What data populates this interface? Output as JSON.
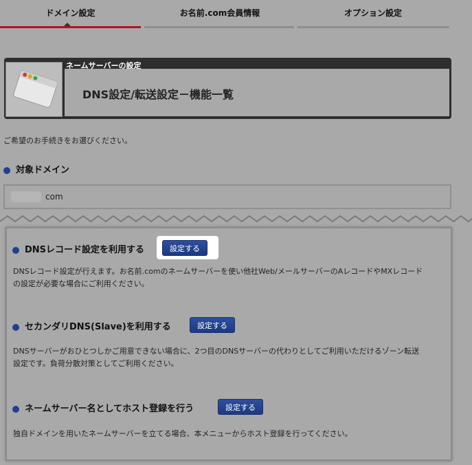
{
  "tabs": [
    {
      "label": "ドメイン設定",
      "active": true
    },
    {
      "label": "お名前.com会員情報",
      "active": false
    },
    {
      "label": "オプション設定",
      "active": false
    }
  ],
  "header": {
    "small_label": "ネームサーバーの設定",
    "title": "DNS設定/転送設定－機能一覧"
  },
  "intro_text": "ご希望のお手続きをお選びください。",
  "target_domain": {
    "heading": "対象ドメイン",
    "value_suffix": "com"
  },
  "options": [
    {
      "title": "DNSレコード設定を利用する",
      "button": "設定する",
      "desc_line1": "DNSレコード設定が行えます。お名前.comのネームサーバーを使い他社Web/メールサーバーのAレコードやMXレコード",
      "desc_line2": "の設定が必要な場合にご利用ください。"
    },
    {
      "title": "セカンダリDNS(Slave)を利用する",
      "button": "設定する",
      "desc_line1": "DNSサーバーがおひとつしかご用意できない場合に、2つ目のDNSサーバーの代わりとしてご利用いただけるゾーン転送",
      "desc_line2": "設定です。負荷分散対策としてご利用ください。"
    },
    {
      "title": "ネームサーバー名としてホスト登録を行う",
      "button": "設定する",
      "desc_line1": "独自ドメインを用いたネームサーバーを立てる場合、本メニューからホスト登録を行ってください。"
    }
  ],
  "colors": {
    "background": "#a9a9a9",
    "active_tab": "#b3121f",
    "button": "#1f3f8f",
    "header_frame": "#2e2e2e"
  }
}
